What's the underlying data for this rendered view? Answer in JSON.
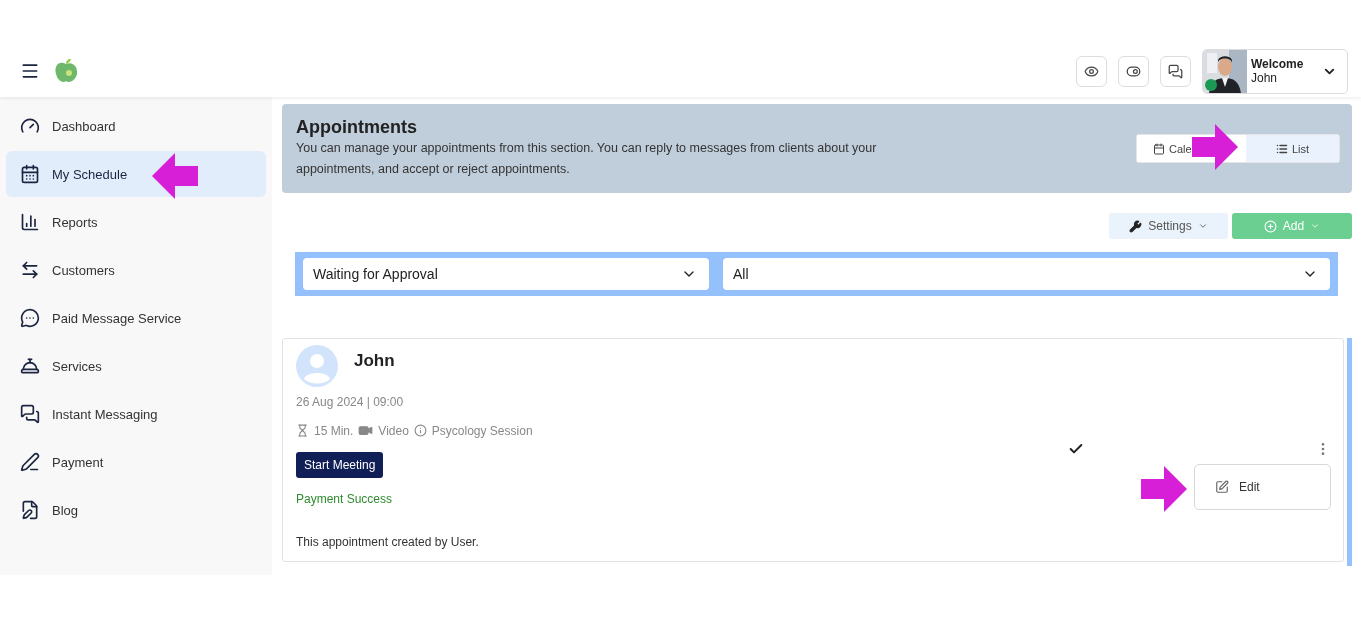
{
  "header": {
    "welcome": "Welcome",
    "user_name": "John",
    "online": true
  },
  "sidebar": {
    "items": [
      {
        "label": "Dashboard",
        "selected": false
      },
      {
        "label": "My Schedule",
        "selected": true
      },
      {
        "label": "Reports",
        "selected": false
      },
      {
        "label": "Customers",
        "selected": false
      },
      {
        "label": "Paid Message Service",
        "selected": false
      },
      {
        "label": "Services",
        "selected": false
      },
      {
        "label": "Instant Messaging",
        "selected": false
      },
      {
        "label": "Payment",
        "selected": false
      },
      {
        "label": "Blog",
        "selected": false
      }
    ]
  },
  "banner": {
    "title": "Appointments",
    "description": "You can manage your appointments from this section. You can reply to messages from clients about your appointments, and accept or reject appointments.",
    "view_toggle": [
      {
        "label": "Cale",
        "selected": false
      },
      {
        "label": "List",
        "selected": true
      }
    ]
  },
  "toolbar": {
    "settings": "Settings",
    "add": "Add"
  },
  "filters": [
    {
      "value": "Waiting for Approval"
    },
    {
      "value": "All"
    }
  ],
  "appointment": {
    "name": "John",
    "datetime": "26 Aug 2024 | 09:00",
    "duration": "15 Min.",
    "mode": "Video",
    "service": "Psycology Session",
    "start_button": "Start Meeting",
    "payment_status": "Payment Success",
    "note": "This appointment created by User.",
    "approved": true,
    "menu": {
      "items": [
        "Edit"
      ]
    }
  }
}
